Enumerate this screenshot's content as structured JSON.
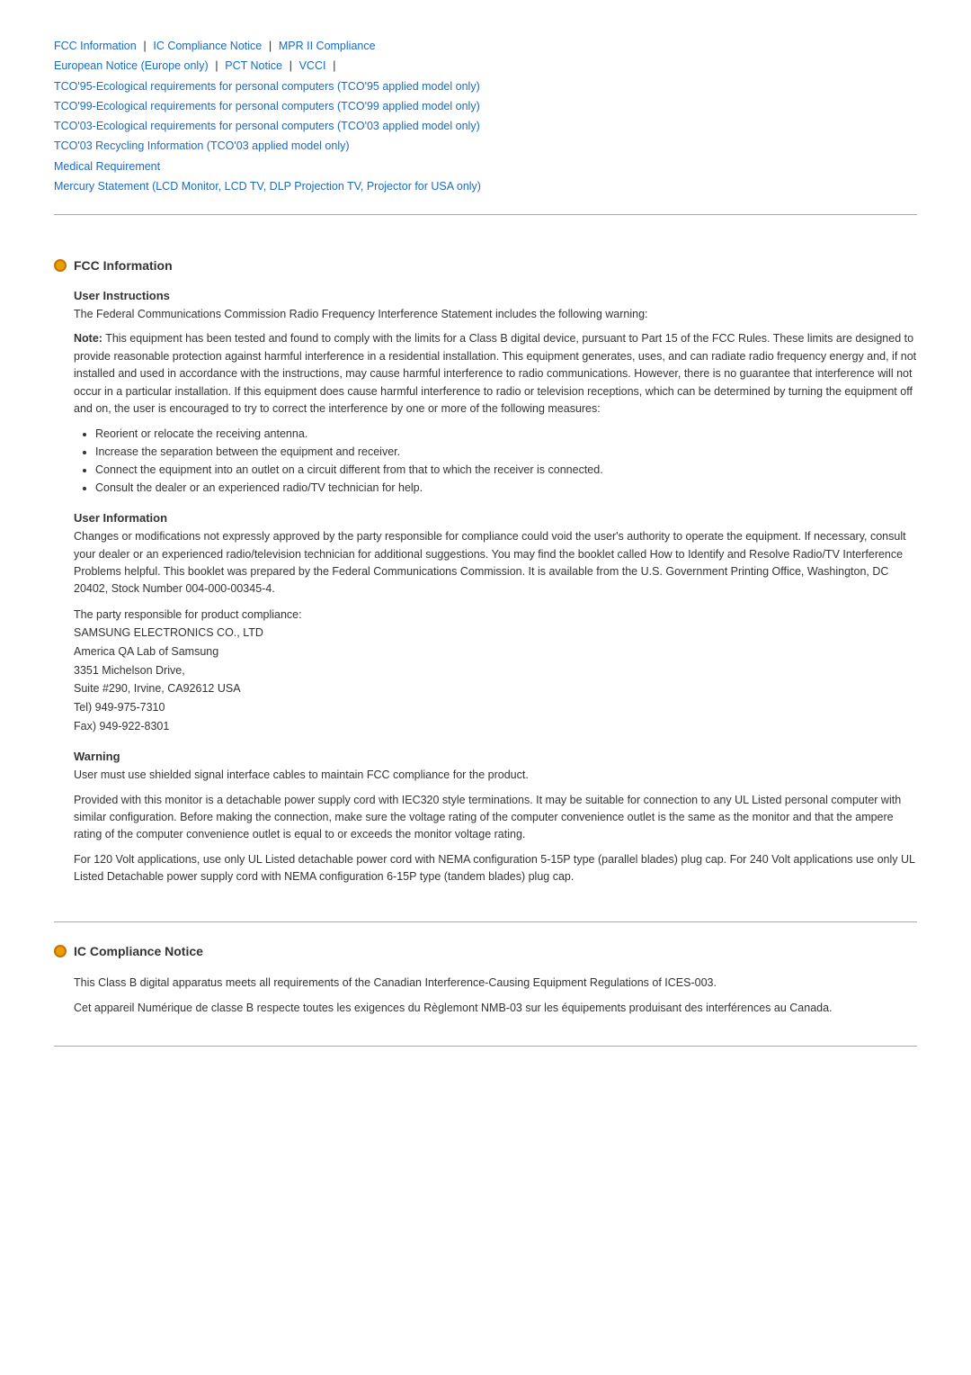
{
  "nav": {
    "links": [
      {
        "label": "FCC Information",
        "id": "fcc"
      },
      {
        "label": "IC Compliance Notice",
        "id": "ic"
      },
      {
        "label": "MPR II Compliance",
        "id": "mpr"
      },
      {
        "label": "European Notice (Europe only)",
        "id": "euro"
      },
      {
        "label": "PCT Notice",
        "id": "pct"
      },
      {
        "label": "VCCI",
        "id": "vcci"
      },
      {
        "label": "TCO'95-Ecological requirements for personal computers (TCO'95 applied model only)",
        "id": "tco95"
      },
      {
        "label": "TCO'99-Ecological requirements for personal computers (TCO'99 applied model only)",
        "id": "tco99"
      },
      {
        "label": "TCO'03-Ecological requirements for personal computers (TCO'03 applied model only)",
        "id": "tco03"
      },
      {
        "label": "TCO'03 Recycling Information (TCO'03 applied model only)",
        "id": "tco03rec"
      },
      {
        "label": "Medical Requirement",
        "id": "medical"
      },
      {
        "label": "Mercury Statement (LCD Monitor, LCD TV, DLP Projection TV, Projector for USA only)",
        "id": "mercury"
      }
    ]
  },
  "sections": {
    "fcc": {
      "title": "FCC Information",
      "sub_sections": {
        "user_instructions": {
          "title": "User Instructions",
          "intro": "The Federal Communications Commission Radio Frequency Interference Statement includes the following warning:",
          "note_bold": "Note:",
          "note_text": " This equipment has been tested and found to comply with the limits for a Class B digital device, pursuant to Part 15 of the FCC Rules. These limits are designed to provide reasonable protection against harmful interference in a residential installation. This equipment generates, uses, and can radiate radio frequency energy and, if not installed and used in accordance with the instructions, may cause harmful interference to radio communications. However, there is no guarantee that interference will not occur in a particular installation. If this equipment does cause harmful interference to radio or television receptions, which can be determined by turning the equipment off and on, the user is encouraged to try to correct the interference by one or more of the following measures:",
          "bullets": [
            "Reorient or relocate the receiving antenna.",
            "Increase the separation between the equipment and receiver.",
            "Connect the equipment into an outlet on a circuit different from that to which the receiver is connected.",
            "Consult the dealer or an experienced radio/TV technician for help."
          ]
        },
        "user_information": {
          "title": "User Information",
          "paragraph1": "Changes or modifications not expressly approved by the party responsible for compliance could void the user's authority to operate the equipment. If necessary, consult your dealer or an experienced radio/television technician for additional suggestions. You may find the booklet called How to Identify and Resolve Radio/TV Interference Problems helpful. This booklet was prepared by the Federal Communications Commission. It is available from the U.S. Government Printing Office, Washington, DC 20402, Stock Number 004-000-00345-4.",
          "address_intro": "The party responsible for product compliance:",
          "address_lines": [
            "SAMSUNG ELECTRONICS CO., LTD",
            "America QA Lab of Samsung",
            "3351 Michelson Drive,",
            "Suite #290, Irvine, CA92612 USA",
            "Tel) 949-975-7310",
            "Fax) 949-922-8301"
          ]
        },
        "warning": {
          "title": "Warning",
          "paragraph1": "User must use shielded signal interface cables to maintain FCC compliance for the product.",
          "paragraph2": "Provided with this monitor is a detachable power supply cord with IEC320 style terminations. It may be suitable for connection to any UL Listed personal computer with similar configuration. Before making the connection, make sure the voltage rating of the computer convenience outlet is the same as the monitor and that the ampere rating of the computer convenience outlet is equal to or exceeds the monitor voltage rating.",
          "paragraph3": "For 120 Volt applications, use only UL Listed detachable power cord with NEMA configuration 5-15P type (parallel blades) plug cap. For 240 Volt applications use only UL Listed Detachable power supply cord with NEMA configuration 6-15P type (tandem blades) plug cap."
        }
      }
    },
    "ic": {
      "title": "IC Compliance Notice",
      "paragraph1": "This Class B digital apparatus meets all requirements of the Canadian Interference-Causing Equipment Regulations of ICES-003.",
      "paragraph2": "Cet appareil Numérique de classe B respecte toutes les exigences du Règlemont NMB-03 sur les équipements produisant des interférences au Canada."
    }
  }
}
